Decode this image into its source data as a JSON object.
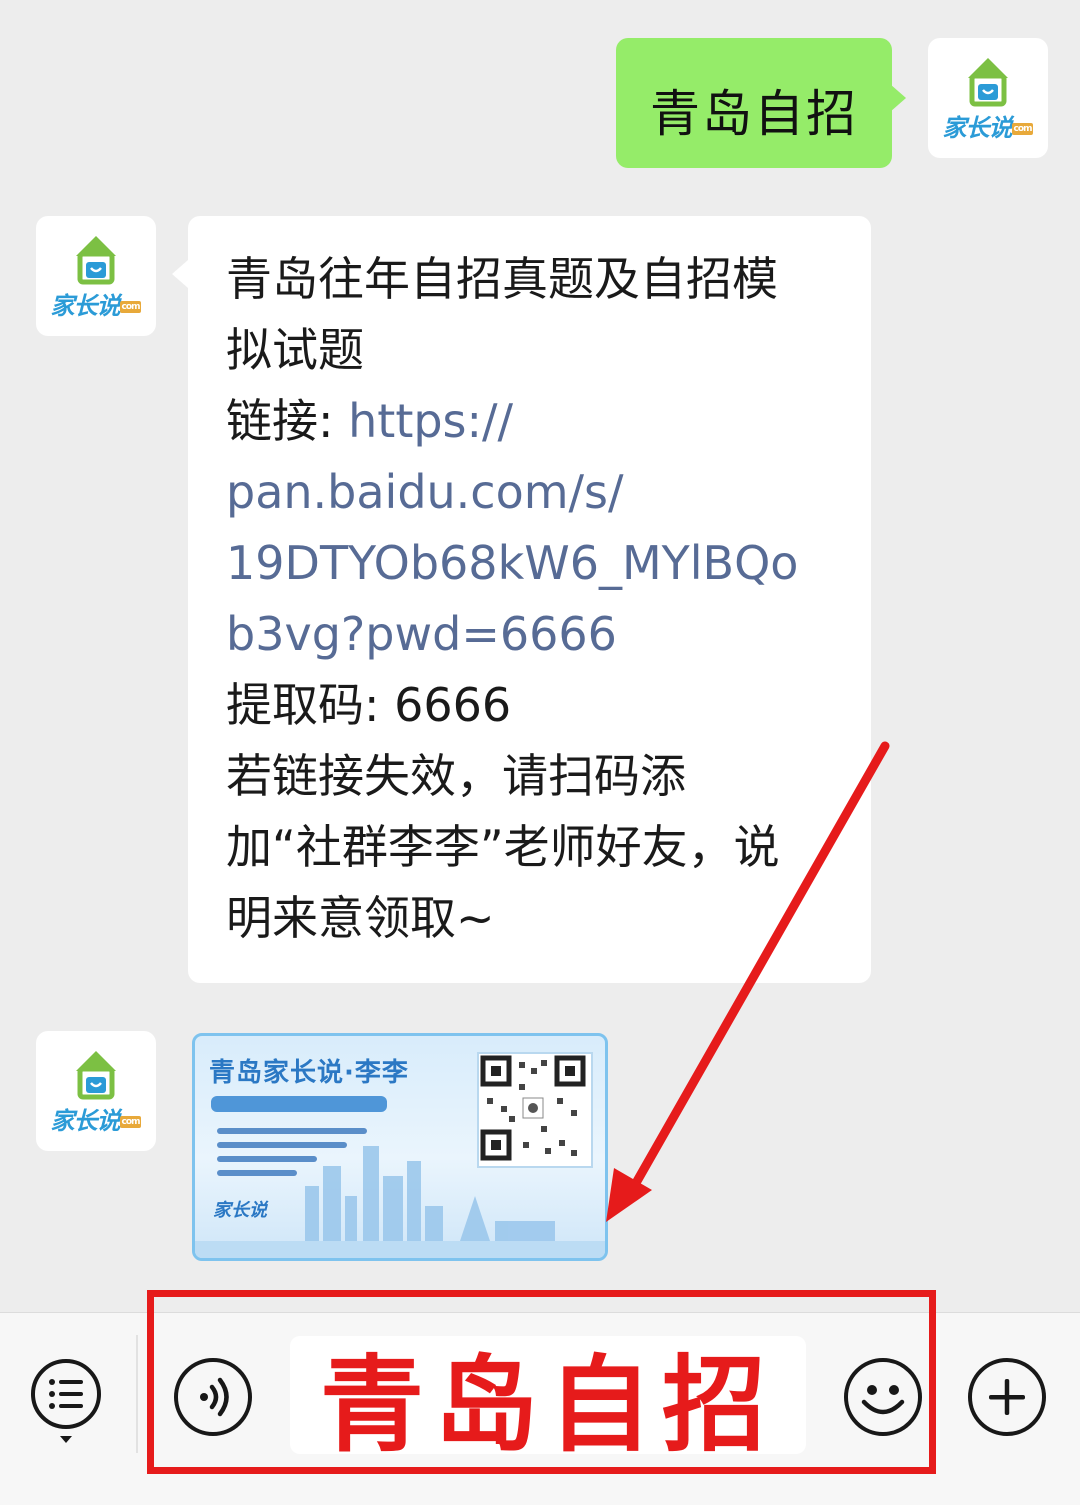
{
  "avatar": {
    "logo_text": "家长说",
    "logo_suffix": "com"
  },
  "messages": {
    "outgoing_1": "青岛自招",
    "incoming_text": {
      "line1": "青岛往年自招真题及自招模",
      "line2": "拟试题",
      "link_label": "链接: ",
      "link_line1": "https://",
      "link_line2": "pan.baidu.com/s/",
      "link_line3": "19DTYOb68kW6_MYlBQo",
      "link_line4": "b3vg?pwd=6666",
      "code_label": "提取码: 6666",
      "note_line1": "若链接失效，请扫码添",
      "note_line2": "加“社群李李”老师好友，说",
      "note_line3": "明来意领取~"
    },
    "image_card": {
      "title": "青岛家长说·李李",
      "logo": "家长说"
    }
  },
  "toolbar": {
    "input_value": "青岛自招",
    "icons": [
      "menu-icon",
      "voice-icon",
      "emoji-icon",
      "plus-icon"
    ]
  },
  "colors": {
    "outgoing_bubble": "#95ec69",
    "link": "#576b95",
    "highlight_red": "#e61b1b",
    "background": "#ededed"
  }
}
